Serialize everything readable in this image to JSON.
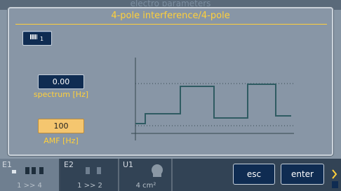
{
  "background": {
    "title": "electro parameters"
  },
  "dialog": {
    "title": "4-pole interference/4-pole",
    "channel_button": {
      "icon": "channel-grid-icon",
      "number": "1"
    },
    "spectrum": {
      "value": "0.00",
      "label": "spectrum [Hz]"
    },
    "amf": {
      "value": "100",
      "label": "AMF [Hz]"
    },
    "graph": {
      "type": "step-waveform",
      "pattern_levels": [
        0,
        1,
        1,
        3,
        3,
        1,
        1,
        3,
        3,
        2
      ],
      "line_color": "#2f5b62",
      "dotted_levels": "2"
    }
  },
  "bottom": {
    "tiles": [
      {
        "id": "E1",
        "icon": "electrodes-icon",
        "footer": "1 >> 4"
      },
      {
        "id": "E2",
        "icon": "electrodes-icon",
        "footer": "1 >> 2"
      },
      {
        "id": "U1",
        "icon": "ultrasound-head-icon",
        "footer": "4 cm²"
      }
    ],
    "esc_label": "esc",
    "enter_label": "enter"
  },
  "colors": {
    "accent": "#ffd03a",
    "button_bg": "#0f2c52",
    "active_field": "#f5c66f",
    "dialog_bg": "#8896a6"
  }
}
